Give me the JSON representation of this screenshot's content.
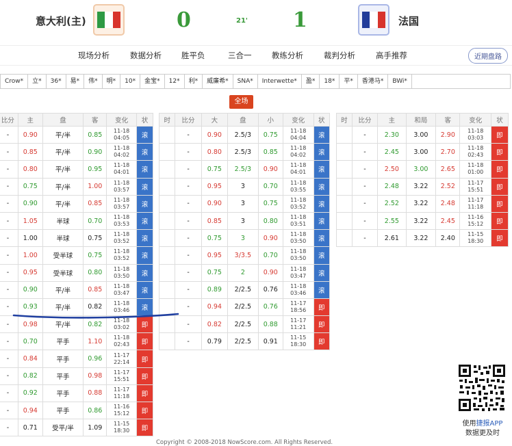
{
  "match": {
    "home_team": "意大利(主)",
    "away_team": "法国",
    "home_score": "0",
    "away_score": "1",
    "minute": "21'"
  },
  "nav": {
    "items": [
      "现场分析",
      "数据分析",
      "胜平负",
      "三合一",
      "教练分析",
      "裁判分析",
      "高手推荐"
    ],
    "recent_button": "近期盘路"
  },
  "bookmakers": [
    "Crow*",
    "立*",
    "36*",
    "易*",
    "伟*",
    "明*",
    "10*",
    "金宝*",
    "12*",
    "利*",
    "威廉希*",
    "SNA*",
    "Interwette*",
    "盈*",
    "18*",
    "平*",
    "香港马*",
    "BWi*"
  ],
  "all_button": "全场",
  "table1": {
    "headers": [
      "比分",
      "主",
      "盘",
      "客",
      "变化",
      "状"
    ],
    "rows": [
      [
        "-",
        "0.90",
        "平/半",
        "0.85",
        "11-18",
        "04:05",
        "滚"
      ],
      [
        "-",
        "0.85",
        "平/半",
        "0.90",
        "11-18",
        "04:02",
        "滚"
      ],
      [
        "-",
        "0.80",
        "平/半",
        "0.95",
        "11-18",
        "04:01",
        "滚"
      ],
      [
        "-",
        "0.75",
        "平/半",
        "1.00",
        "11-18",
        "03:57",
        "滚"
      ],
      [
        "-",
        "0.90",
        "平/半",
        "0.85",
        "11-18",
        "03:57",
        "滚"
      ],
      [
        "-",
        "1.05",
        "半球",
        "0.70",
        "11-18",
        "03:53",
        "滚"
      ],
      [
        "-",
        "1.00",
        "半球",
        "0.75",
        "11-18",
        "03:52",
        "滚"
      ],
      [
        "-",
        "1.00",
        "受半球",
        "0.75",
        "11-18",
        "03:52",
        "滚"
      ],
      [
        "-",
        "0.95",
        "受半球",
        "0.80",
        "11-18",
        "03:50",
        "滚"
      ],
      [
        "-",
        "0.90",
        "平/半",
        "0.85",
        "11-18",
        "03:47",
        "滚"
      ],
      [
        "-",
        "0.93",
        "平/半",
        "0.82",
        "11-18",
        "03:46",
        "滚"
      ],
      [
        "-",
        "0.98",
        "平/半",
        "0.82",
        "11-18",
        "03:02",
        "即"
      ],
      [
        "-",
        "0.70",
        "平手",
        "1.10",
        "11-18",
        "02:43",
        "即"
      ],
      [
        "-",
        "0.84",
        "平手",
        "0.96",
        "11-17",
        "22:14",
        "即"
      ],
      [
        "-",
        "0.82",
        "平手",
        "0.98",
        "11-17",
        "15:51",
        "即"
      ],
      [
        "-",
        "0.92",
        "平手",
        "0.88",
        "11-17",
        "11:18",
        "即"
      ],
      [
        "-",
        "0.94",
        "平手",
        "0.86",
        "11-16",
        "15:12",
        "即"
      ],
      [
        "-",
        "0.71",
        "受平/半",
        "1.09",
        "11-15",
        "18:30",
        "即"
      ]
    ]
  },
  "table2": {
    "headers": [
      "时",
      "比分",
      "大",
      "盘",
      "小",
      "变化",
      "状"
    ],
    "rows": [
      [
        "",
        "-",
        "0.90",
        "2.5/3",
        "0.75",
        "11-18",
        "04:04",
        "滚"
      ],
      [
        "",
        "-",
        "0.80",
        "2.5/3",
        "0.85",
        "11-18",
        "04:02",
        "滚"
      ],
      [
        "",
        "-",
        "0.75",
        "2.5/3",
        "0.90",
        "11-18",
        "04:01",
        "滚"
      ],
      [
        "",
        "-",
        "0.95",
        "3",
        "0.70",
        "11-18",
        "03:55",
        "滚"
      ],
      [
        "",
        "-",
        "0.90",
        "3",
        "0.75",
        "11-18",
        "03:52",
        "滚"
      ],
      [
        "",
        "-",
        "0.85",
        "3",
        "0.80",
        "11-18",
        "03:51",
        "滚"
      ],
      [
        "",
        "-",
        "0.75",
        "3",
        "0.90",
        "11-18",
        "03:50",
        "滚"
      ],
      [
        "",
        "-",
        "0.95",
        "3/3.5",
        "0.70",
        "11-18",
        "03:50",
        "滚"
      ],
      [
        "",
        "-",
        "0.75",
        "2",
        "0.90",
        "11-18",
        "03:47",
        "滚"
      ],
      [
        "",
        "-",
        "0.89",
        "2/2.5",
        "0.76",
        "11-18",
        "03:46",
        "滚"
      ],
      [
        "",
        "-",
        "0.94",
        "2/2.5",
        "0.76",
        "11-17",
        "18:56",
        "即"
      ],
      [
        "",
        "-",
        "0.82",
        "2/2.5",
        "0.88",
        "11-17",
        "11:21",
        "即"
      ],
      [
        "",
        "-",
        "0.79",
        "2/2.5",
        "0.91",
        "11-15",
        "18:30",
        "即"
      ]
    ]
  },
  "table3": {
    "headers": [
      "时",
      "比分",
      "主",
      "和局",
      "客",
      "变化",
      "状"
    ],
    "rows": [
      [
        "",
        "-",
        "2.30",
        "3.00",
        "2.90",
        "11-18",
        "03:03",
        "即"
      ],
      [
        "",
        "-",
        "2.45",
        "3.00",
        "2.70",
        "11-18",
        "02:43",
        "即"
      ],
      [
        "",
        "-",
        "2.50",
        "3.00",
        "2.65",
        "11-18",
        "01:00",
        "即"
      ],
      [
        "",
        "-",
        "2.48",
        "3.22",
        "2.52",
        "11-17",
        "15:51",
        "即"
      ],
      [
        "",
        "-",
        "2.52",
        "3.22",
        "2.48",
        "11-17",
        "11:18",
        "即"
      ],
      [
        "",
        "-",
        "2.55",
        "3.22",
        "2.45",
        "11-16",
        "15:12",
        "即"
      ],
      [
        "",
        "-",
        "2.61",
        "3.22",
        "2.40",
        "11-15",
        "18:30",
        "即"
      ]
    ]
  },
  "app": {
    "line1_prefix": "使用",
    "line1_link": "捷报APP",
    "line2": "数据更及时"
  },
  "footer": "Copyright © 2008-2018 NowScore.com. All Rights Reserved.",
  "colors": {
    "live_status": "#3a74c8",
    "instant_status": "#e33a2f",
    "up": "#d63a32",
    "down": "#2f9a2f",
    "all_button": "#d9441f"
  }
}
